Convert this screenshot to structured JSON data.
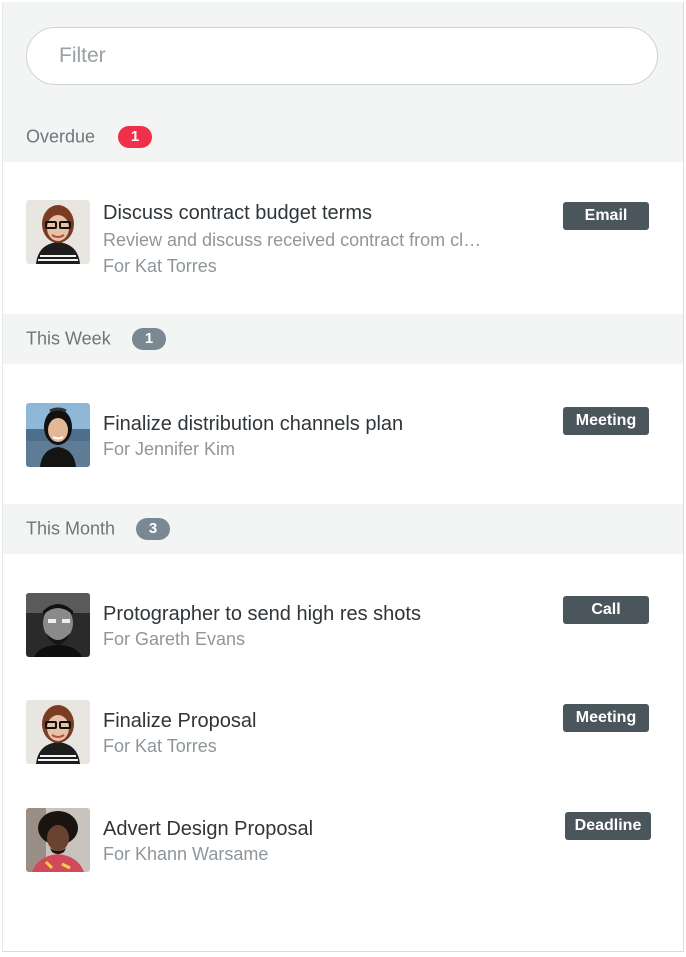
{
  "filter": {
    "placeholder": "Filter",
    "value": ""
  },
  "colors": {
    "overdue_badge": "#f0304a",
    "count_badge": "#7a8893",
    "tag_bg": "#4a555c",
    "section_bg": "#f3f4f4"
  },
  "sections": [
    {
      "title": "Overdue",
      "count": "1",
      "tasks": [
        {
          "title": "Discuss contract budget terms",
          "description": "Review and discuss received contract from cl…",
          "owner": "For Kat Torres",
          "tag": "Email",
          "avatar": "kat-torres-avatar"
        }
      ]
    },
    {
      "title": "This Week",
      "count": "1",
      "tasks": [
        {
          "title": "Finalize distribution channels plan",
          "owner": "For Jennifer Kim",
          "tag": "Meeting",
          "avatar": "jennifer-kim-avatar"
        }
      ]
    },
    {
      "title": "This Month",
      "count": "3",
      "tasks": [
        {
          "title": "Protographer to send high res shots",
          "owner": "For Gareth Evans",
          "tag": "Call",
          "avatar": "gareth-evans-avatar"
        },
        {
          "title": "Finalize Proposal",
          "owner": "For Kat Torres",
          "tag": "Meeting",
          "avatar": "kat-torres-avatar"
        },
        {
          "title": "Advert Design Proposal",
          "owner": "For Khann Warsame",
          "tag": "Deadline",
          "avatar": "khann-warsame-avatar"
        }
      ]
    }
  ]
}
